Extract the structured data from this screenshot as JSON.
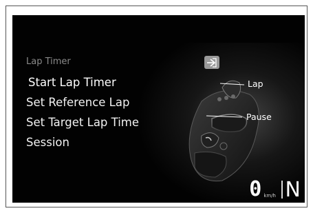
{
  "menu": {
    "title": "Lap Timer",
    "items": [
      {
        "label": "Start Lap Timer",
        "selected": true
      },
      {
        "label": "Set Reference Lap",
        "selected": false
      },
      {
        "label": "Set Target Lap Time",
        "selected": false
      },
      {
        "label": "Session",
        "selected": false
      }
    ]
  },
  "enter_icon": "enter-arrow-icon",
  "callouts": {
    "lap_label": "Lap",
    "pause_label": "Pause"
  },
  "status": {
    "speed": "0",
    "speed_unit": "km/h",
    "gear": "N"
  },
  "colors": {
    "screen_bg": "#020202",
    "menu_header": "#8a8a8a",
    "text": "#ffffff",
    "badge": "#9a9a9a"
  }
}
